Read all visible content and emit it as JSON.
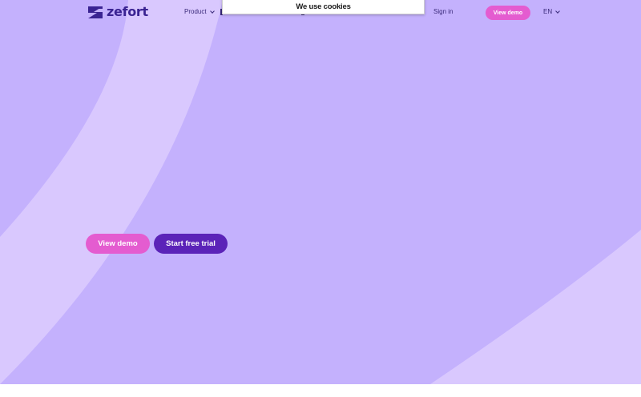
{
  "brand": {
    "name": "zefort",
    "logo_icon": "z-logo-icon"
  },
  "nav": {
    "product_label": "Product",
    "sign_in_label": "Sign in",
    "view_demo_label": "View demo",
    "language_label": "EN"
  },
  "cookie_banner": {
    "title": "We use cookies"
  },
  "hero": {
    "view_demo_label": "View demo",
    "start_trial_label": "Start free trial"
  },
  "colors": {
    "background": "#c4b1fd",
    "background_curve": "#d9c8fe",
    "brand_text": "#3a2392",
    "demo_button": "#e45cd0",
    "trial_button": "#5b23b8"
  }
}
